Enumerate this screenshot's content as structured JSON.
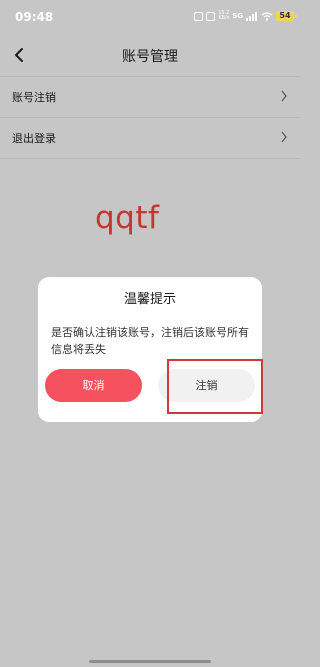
{
  "status_bar": {
    "time": "09:48",
    "network_speed_top": "15.2",
    "network_speed_unit": "KB/s",
    "signal": "5G",
    "battery": "54"
  },
  "header": {
    "title": "账号管理",
    "back_icon": "chevron-left-icon"
  },
  "menu": {
    "items": [
      {
        "label": "账号注销",
        "icon": "chevron-right-icon"
      },
      {
        "label": "退出登录",
        "icon": "chevron-right-icon"
      }
    ]
  },
  "watermark": {
    "text": "qqtf",
    "color": "#c8342e"
  },
  "dialog": {
    "title": "温馨提示",
    "message": "是否确认注销该账号，注销后该账号所有信息将丢失",
    "cancel_label": "取消",
    "confirm_label": "注销"
  },
  "colors": {
    "overlay": "#c6c6c6",
    "cancel_button": "#f5515f",
    "confirm_button": "#f1f1f1",
    "highlight": "#cf3b3b"
  }
}
